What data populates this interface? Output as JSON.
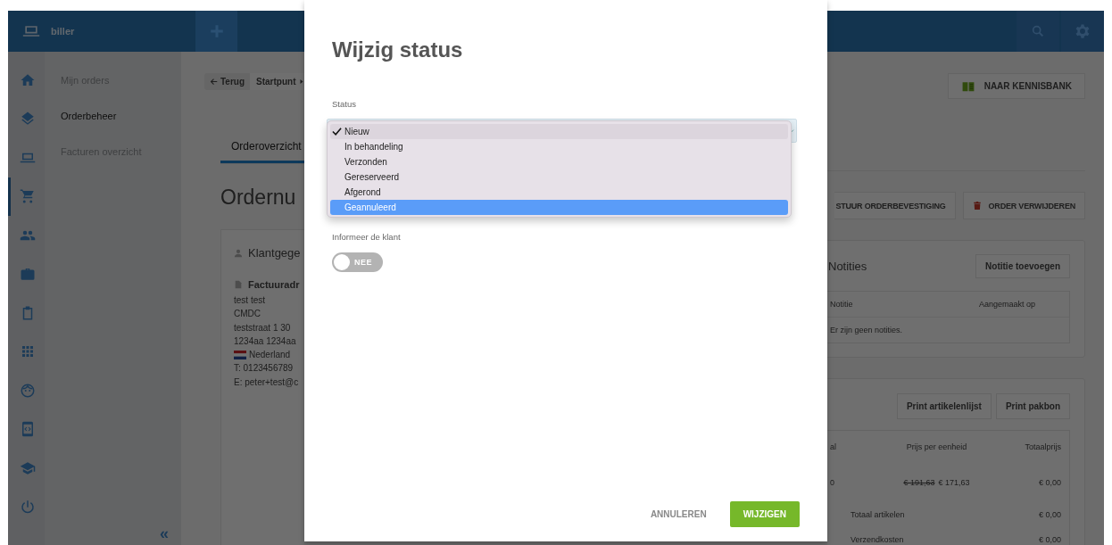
{
  "top_bar": {
    "app_name": "biller"
  },
  "rail": [
    {
      "selected": false
    },
    {
      "selected": false
    },
    {
      "selected": false
    },
    {
      "selected": true
    },
    {
      "selected": false
    },
    {
      "selected": false
    },
    {
      "selected": false
    },
    {
      "selected": false
    },
    {
      "selected": false
    },
    {
      "selected": false
    },
    {
      "selected": false
    },
    {
      "selected": false
    }
  ],
  "subnav": {
    "items": [
      {
        "label": "Mijn orders",
        "selected": false
      },
      {
        "label": "Orderbeheer",
        "selected": true
      },
      {
        "label": "Facturen overzicht",
        "selected": false
      }
    ],
    "collapse": "«"
  },
  "breadcrumb": {
    "back": "Terug",
    "current": "Startpunt"
  },
  "tabs": [
    {
      "label": "Orderoverzicht",
      "selected": true
    }
  ],
  "heading": "Ordernu",
  "customer_card": {
    "title": "Klantgege",
    "address": {
      "title": "Factuuradr",
      "name": "test test",
      "company": "CMDC",
      "street": "teststraat 1 30",
      "postcode_city": "1234aa 1234aa",
      "country": "Nederland",
      "phone": "T: 0123456789",
      "email": "E: peter+test@c"
    }
  },
  "kennisbank_button": "NAAR KENNISBANK",
  "action_buttons": [
    {
      "label": "STUUR ORDERBEVESTIGING",
      "kind": "plain"
    },
    {
      "label": "ORDER VERWIJDEREN",
      "kind": "delete"
    }
  ],
  "notes": {
    "title": "Notities",
    "add_button": "Notitie toevoegen",
    "columns": [
      "Notitie",
      "Aangemaakt op"
    ],
    "empty": "Er zijn geen notities."
  },
  "items": {
    "buttons": [
      "Print artikelenlijst",
      "Print pakbon"
    ],
    "columns": [
      "al",
      "Prijs per eenheid",
      "Totaalprijs"
    ],
    "rows": [
      {
        "quantity": "0",
        "old_price": "€ 191,63",
        "price": "€ 171,63",
        "total": "€ 0,00"
      }
    ],
    "summary": [
      {
        "label": "Totaal artikelen",
        "value": "€ 0,00"
      },
      {
        "label": "Verzendkosten",
        "value": "€ 0,00"
      }
    ]
  },
  "dialog": {
    "title": "Wijzig status",
    "status_label": "Status",
    "options": [
      {
        "label": "Nieuw",
        "selected": true,
        "highlighted": false
      },
      {
        "label": "In behandeling",
        "selected": false,
        "highlighted": false
      },
      {
        "label": "Verzonden",
        "selected": false,
        "highlighted": false
      },
      {
        "label": "Gereserveerd",
        "selected": false,
        "highlighted": false
      },
      {
        "label": "Afgerond",
        "selected": false,
        "highlighted": false
      },
      {
        "label": "Geannuleerd",
        "selected": false,
        "highlighted": true
      }
    ],
    "notify_label": "Informeer de klant",
    "notify_toggle": {
      "on": false,
      "label": "NEE"
    },
    "cancel_button": "ANNULEREN",
    "confirm_button": "WIJZIGEN"
  }
}
